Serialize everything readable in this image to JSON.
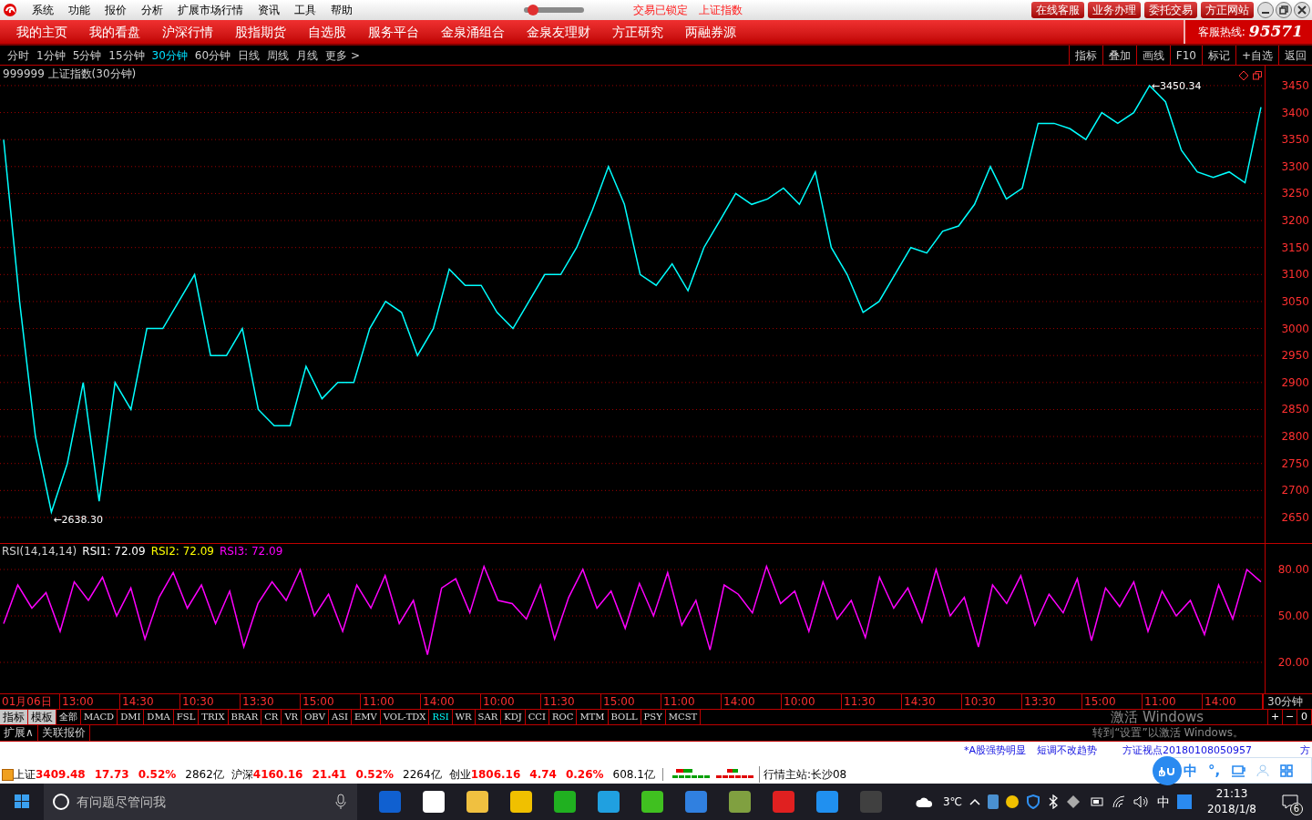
{
  "title_bar": {
    "menu": [
      "系统",
      "功能",
      "报价",
      "分析",
      "扩展市场行情",
      "资讯",
      "工具",
      "帮助"
    ],
    "slider": {
      "level": 0.08
    },
    "status_texts": [
      "交易已锁定",
      "上证指数"
    ],
    "buttons": [
      "在线客服",
      "业务办理",
      "委托交易",
      "方正网站"
    ]
  },
  "nav": {
    "items": [
      "我的主页",
      "我的看盘",
      "沪深行情",
      "股指期货",
      "自选股",
      "服务平台",
      "金泉涌组合",
      "金泉友理财",
      "方正研究",
      "两融券源"
    ],
    "hotline_label": "客服热线:",
    "hotline": "95571"
  },
  "toolbar": {
    "periods": [
      {
        "label": "分时",
        "selected": false
      },
      {
        "label": "1分钟",
        "selected": false
      },
      {
        "label": "5分钟",
        "selected": false
      },
      {
        "label": "15分钟",
        "selected": false
      },
      {
        "label": "30分钟",
        "selected": true
      },
      {
        "label": "60分钟",
        "selected": false
      },
      {
        "label": "日线",
        "selected": false
      },
      {
        "label": "周线",
        "selected": false
      },
      {
        "label": "月线",
        "selected": false
      }
    ],
    "more": "更多 >",
    "actions": [
      "指标",
      "叠加",
      "画线",
      "F10",
      "标记",
      "+自选",
      "返回"
    ]
  },
  "price_chart": {
    "title": "999999 上证指数(30分钟)",
    "chart_data": {
      "type": "line",
      "series": [
        {
          "color": "#00ffff",
          "values": [
            3350,
            3050,
            2800,
            2660,
            2750,
            2900,
            2680,
            2900,
            2850,
            3000,
            3000,
            3050,
            3100,
            2950,
            2950,
            3000,
            2850,
            2820,
            2820,
            2930,
            2870,
            2900,
            2900,
            3000,
            3050,
            3030,
            2950,
            3000,
            3110,
            3080,
            3080,
            3030,
            3000,
            3050,
            3100,
            3100,
            3150,
            3220,
            3300,
            3230,
            3100,
            3080,
            3120,
            3070,
            3150,
            3200,
            3250,
            3230,
            3240,
            3260,
            3230,
            3290,
            3150,
            3100,
            3030,
            3050,
            3100,
            3150,
            3140,
            3180,
            3190,
            3230,
            3300,
            3240,
            3260,
            3380,
            3380,
            3370,
            3350,
            3400,
            3380,
            3400,
            3450,
            3420,
            3330,
            3290,
            3280,
            3290,
            3270,
            3410
          ]
        }
      ],
      "ylim": [
        2601,
        3487
      ],
      "yticks": [
        2650,
        2700,
        2750,
        2800,
        2850,
        2900,
        2950,
        3000,
        3050,
        3100,
        3150,
        3200,
        3250,
        3300,
        3350,
        3400,
        3450
      ],
      "grid": true,
      "annotations": [
        "←3450.34",
        "←2638.30"
      ]
    }
  },
  "rsi_chart": {
    "title": "RSI(14,14,14)",
    "readings": [
      {
        "label": "RSI1: 72.09",
        "color": "#ffffff"
      },
      {
        "label": "RSI2: 72.09",
        "color": "#ffff00"
      },
      {
        "label": "RSI3: 72.09",
        "color": "#ff00ff"
      }
    ],
    "chart_data": {
      "type": "line",
      "series": [
        {
          "color": "#ff00ff",
          "values": [
            45,
            70,
            55,
            65,
            40,
            72,
            60,
            75,
            50,
            68,
            35,
            62,
            78,
            55,
            70,
            45,
            66,
            30,
            58,
            72,
            60,
            80,
            50,
            64,
            40,
            70,
            55,
            76,
            45,
            60,
            25,
            68,
            74,
            52,
            82,
            60,
            58,
            48,
            70,
            35,
            62,
            80,
            55,
            66,
            42,
            71,
            50,
            78,
            44,
            60,
            28,
            70,
            64,
            52,
            82,
            58,
            66,
            40,
            72,
            48,
            60,
            36,
            75,
            55,
            68,
            46,
            80,
            50,
            62,
            30,
            70,
            58,
            76,
            44,
            64,
            52,
            74,
            34,
            68,
            56,
            72,
            40,
            66,
            50,
            60,
            38,
            70,
            48,
            80,
            72
          ]
        }
      ],
      "grid": true,
      "ylim": [
        -0.6,
        96.5
      ],
      "yticks": [
        {
          "value": 20,
          "label": "20.00"
        },
        {
          "value": 50,
          "label": "50.00"
        },
        {
          "value": 80,
          "label": "80.00"
        }
      ]
    }
  },
  "time_axis": {
    "labels": [
      "01月06日",
      "13:00",
      "14:30",
      "10:30",
      "13:30",
      "15:00",
      "11:00",
      "14:00",
      "10:00",
      "11:30",
      "15:00",
      "11:00",
      "14:00",
      "10:00",
      "11:30",
      "14:30",
      "10:30",
      "13:30",
      "15:00",
      "11:00",
      "14:00"
    ],
    "period": "30分钟"
  },
  "indicator_tabs": [
    {
      "label": "指标",
      "kind": "panel",
      "selected": false
    },
    {
      "label": "模板",
      "kind": "panel",
      "selected": false
    },
    {
      "label": "全部",
      "kind": "indicator",
      "selected": false
    },
    {
      "label": "MACD",
      "kind": "indicator",
      "selected": false
    },
    {
      "label": "DMI",
      "kind": "indicator",
      "selected": false
    },
    {
      "label": "DMA",
      "kind": "indicator",
      "selected": false
    },
    {
      "label": "FSL",
      "kind": "indicator",
      "selected": false
    },
    {
      "label": "TRIX",
      "kind": "indicator",
      "selected": false
    },
    {
      "label": "BRAR",
      "kind": "indicator",
      "selected": false
    },
    {
      "label": "CR",
      "kind": "indicator",
      "selected": false
    },
    {
      "label": "VR",
      "kind": "indicator",
      "selected": false
    },
    {
      "label": "OBV",
      "kind": "indicator",
      "selected": false
    },
    {
      "label": "ASI",
      "kind": "indicator",
      "selected": false
    },
    {
      "label": "EMV",
      "kind": "indicator",
      "selected": false
    },
    {
      "label": "VOL-TDX",
      "kind": "indicator",
      "selected": false
    },
    {
      "label": "RSI",
      "kind": "indicator",
      "selected": true
    },
    {
      "label": "WR",
      "kind": "indicator",
      "selected": false
    },
    {
      "label": "SAR",
      "kind": "indicator",
      "selected": false
    },
    {
      "label": "KDJ",
      "kind": "indicator",
      "selected": false
    },
    {
      "label": "CCI",
      "kind": "indicator",
      "selected": false
    },
    {
      "label": "ROC",
      "kind": "indicator",
      "selected": false
    },
    {
      "label": "MTM",
      "kind": "indicator",
      "selected": false
    },
    {
      "label": "BOLL",
      "kind": "indicator",
      "selected": false
    },
    {
      "label": "PSY",
      "kind": "indicator",
      "selected": false
    },
    {
      "label": "MCST",
      "kind": "indicator",
      "selected": false
    }
  ],
  "zoom_buttons": [
    "+",
    "−",
    "0"
  ],
  "extra_tabs": [
    "扩展∧",
    "关联报价"
  ],
  "activation_notice": {
    "title": "激活 Windows",
    "text": "转到“设置”以激活 Windows。"
  },
  "news_ticker": [
    "*A股强势明显",
    "短调不改趋势",
    "方证视点20180108050957",
    "方"
  ],
  "ime_bar": {
    "items": [
      "中",
      "°,"
    ]
  },
  "status_bar": {
    "indices": [
      {
        "name": "上证",
        "value": "3409.48",
        "change": "17.73",
        "percent": "0.52%",
        "amount": "2862亿"
      },
      {
        "name": "沪深",
        "value": "4160.16",
        "change": "21.41",
        "percent": "0.52%",
        "amount": "2264亿"
      },
      {
        "name": "创业",
        "value": "1806.16",
        "change": "4.74",
        "percent": "0.26%",
        "amount": "608.1亿"
      }
    ],
    "server": "行情主站:长沙08"
  },
  "taskbar": {
    "search_placeholder": "有问题尽管问我",
    "temperature": "3℃",
    "input_method": "中",
    "time": "21:13",
    "date": "2018/1/8",
    "notifications": "6"
  }
}
